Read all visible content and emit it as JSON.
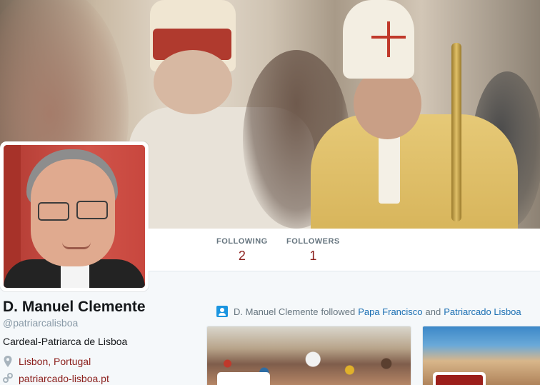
{
  "profile": {
    "name": "D. Manuel Clemente",
    "handle": "@patriarcalisboa",
    "bio": "Cardeal-Patriarca de Lisboa",
    "location": "Lisbon, Portugal",
    "url": "patriarcado-lisboa.pt"
  },
  "stats": {
    "following_label": "FOLLOWING",
    "following_count": "2",
    "followers_label": "FOLLOWERS",
    "followers_count": "1"
  },
  "activity": {
    "actor": "D. Manuel Clemente",
    "verb": "followed",
    "account_1": "Papa Francisco",
    "conjunction": "and",
    "account_2": "Patriarcado Lisboa"
  },
  "icons": {
    "location": "map-pin-icon",
    "url": "link-icon",
    "activity": "person-follow-icon"
  },
  "colors": {
    "link": "#8b1f1c",
    "activity_link": "#1b6fb3",
    "muted": "#8899a6"
  }
}
